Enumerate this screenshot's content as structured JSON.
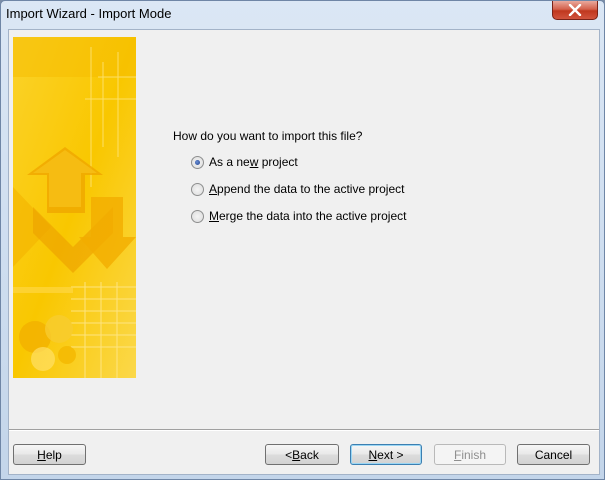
{
  "window": {
    "title": "Import Wizard - Import Mode"
  },
  "question": "How do you want to import this file?",
  "options": [
    {
      "pre": "As a ne",
      "u": "w",
      "post": " project",
      "checked": true
    },
    {
      "pre": "",
      "u": "A",
      "post": "ppend the data to the active project",
      "checked": false
    },
    {
      "pre": "",
      "u": "M",
      "post": "erge the data into the active project",
      "checked": false
    }
  ],
  "buttons": {
    "help": {
      "pre": "",
      "u": "H",
      "post": "elp"
    },
    "back": {
      "pre": "< ",
      "u": "B",
      "post": "ack"
    },
    "next": {
      "pre": "",
      "u": "N",
      "post": "ext >"
    },
    "finish": {
      "pre": "",
      "u": "F",
      "post": "inish"
    },
    "cancel": {
      "pre": "Cancel",
      "u": "",
      "post": ""
    }
  },
  "colors": {
    "banner_yellow": "#f7c500",
    "close_red": "#c7432b",
    "accent_blue": "#3c7fb1"
  }
}
